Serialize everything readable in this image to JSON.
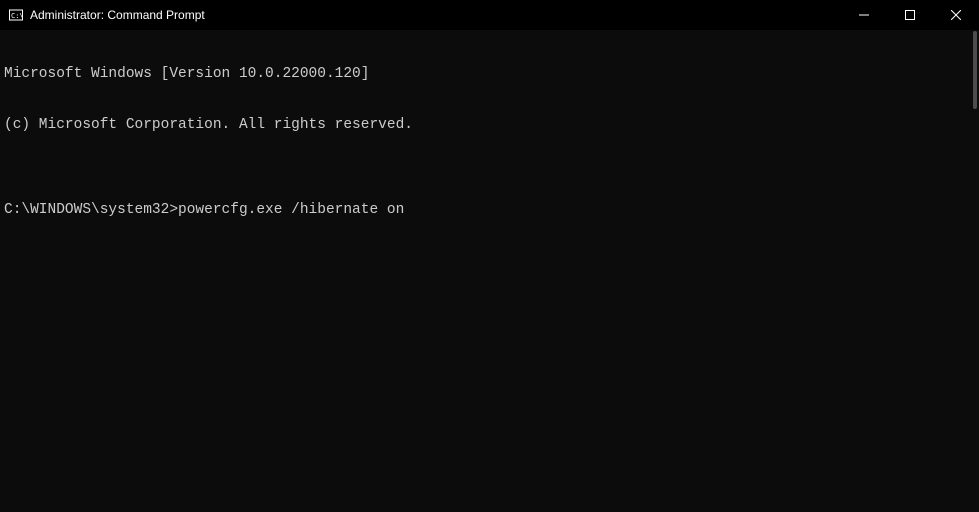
{
  "titlebar": {
    "title": "Administrator: Command Prompt"
  },
  "console": {
    "line1": "Microsoft Windows [Version 10.0.22000.120]",
    "line2": "(c) Microsoft Corporation. All rights reserved.",
    "blank": "",
    "prompt_path": "C:\\WINDOWS\\system32>",
    "prompt_command": "powercfg.exe /hibernate on"
  }
}
